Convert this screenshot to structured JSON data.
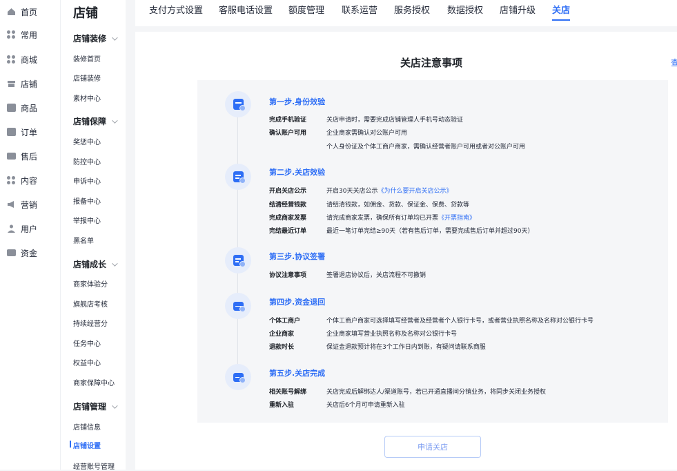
{
  "left_nav": [
    {
      "label": "首页",
      "icon": "home-icon"
    },
    {
      "label": "常用",
      "icon": "grid-icon"
    },
    {
      "label": "商城",
      "icon": "grid-icon"
    },
    {
      "label": "店铺",
      "icon": "store-icon"
    },
    {
      "label": "商品",
      "icon": "box-icon"
    },
    {
      "label": "订单",
      "icon": "document-icon"
    },
    {
      "label": "售后",
      "icon": "card-icon"
    },
    {
      "label": "内容",
      "icon": "grid-icon"
    },
    {
      "label": "营销",
      "icon": "megaphone-icon"
    },
    {
      "label": "用户",
      "icon": "user-icon"
    },
    {
      "label": "资金",
      "icon": "wallet-icon"
    }
  ],
  "sub_nav": {
    "title": "店铺",
    "groups": [
      {
        "label": "店铺装修",
        "items": [
          "装修首页",
          "店铺装修",
          "素材中心"
        ]
      },
      {
        "label": "店铺保障",
        "items": [
          "奖惩中心",
          "防控中心",
          "申诉中心",
          "报备中心",
          "举报中心",
          "黑名单"
        ]
      },
      {
        "label": "店铺成长",
        "items": [
          "商家体验分",
          "旗舰店考核",
          "持续经营分",
          "任务中心",
          "权益中心",
          "商家保障中心"
        ]
      },
      {
        "label": "店铺管理",
        "items": [
          "店铺信息",
          "店铺设置",
          "经营账号管理"
        ]
      }
    ],
    "active_item": "店铺设置"
  },
  "tabs": [
    "支付方式设置",
    "客服电话设置",
    "额度管理",
    "联系运营",
    "服务授权",
    "数据授权",
    "店铺升级",
    "关店"
  ],
  "active_tab": "关店",
  "page_title": "关店注意事项",
  "right_link": "查",
  "steps": [
    {
      "title": "第一步.身份效验",
      "rows": [
        {
          "label": "完成手机验证",
          "value": "关店申请时，需要完成店铺管理人手机号动态验证"
        },
        {
          "label": "确认账户可用",
          "value": "企业商家需确认对公账户可用"
        },
        {
          "label": "",
          "value": "个人身份证及个体工商户商家，需确认经营者账户可用或者对公账户可用"
        }
      ]
    },
    {
      "title": "第二步.关店效验",
      "rows": [
        {
          "label": "开启关店公示",
          "value": "开启30天关店公示",
          "link": "《为什么要开启关店公示》"
        },
        {
          "label": "结清经营钱款",
          "value": "请结清钱款，如佣金、货款、保证金、保费、贷款等"
        },
        {
          "label": "完成商家发票",
          "value": "请完成商家发票，确保所有订单均已开票",
          "link": "《开票指南》"
        },
        {
          "label": "完结最近订单",
          "value": "最近一笔订单完结≥90天（若有售后订单，需要完成售后订单并超过90天）"
        }
      ]
    },
    {
      "title": "第三步.协议签署",
      "rows": [
        {
          "label": "协议注意事项",
          "value": "签署退店协议后，关店流程不可撤销"
        }
      ]
    },
    {
      "title": "第四步.资金退回",
      "rows": [
        {
          "label": "个体工商户",
          "value": "个体工商户商家可选择填写经营者及经营者个人银行卡号，或者营业执照名称及名称对公银行卡号"
        },
        {
          "label": "企业商家",
          "value": "企业商家填写营业执照名称及名称对公银行卡号"
        },
        {
          "label": "退款时长",
          "value": "保证金退款预计将在3个工作日内到账，有疑问请联系商服"
        }
      ]
    },
    {
      "title": "第五步.关店完成",
      "rows": [
        {
          "label": "相关账号解绑",
          "value": "关店完成后解绑达人/渠道账号，若已开通直播间分销业务，将同步关闭业务授权"
        },
        {
          "label": "重新入驻",
          "value": "关店后6个月可申请重新入驻"
        }
      ]
    }
  ],
  "apply_button": "申请关店",
  "colors": {
    "accent": "#2e6ef5",
    "panel_bg": "#f5f6f8",
    "icon_bg": "#e6edfb"
  }
}
